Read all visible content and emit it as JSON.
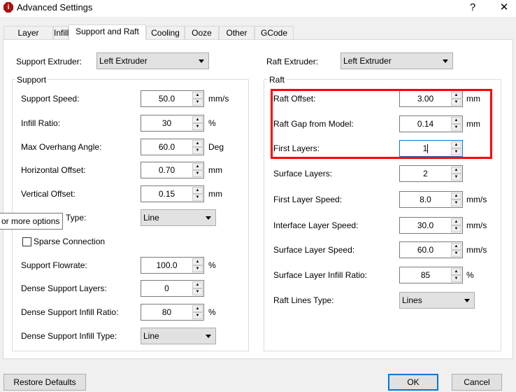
{
  "window": {
    "title": "Advanced Settings",
    "help": "?",
    "close": "✕",
    "icon": "app-logo-icon"
  },
  "tabs": [
    {
      "label": "Layer"
    },
    {
      "label": "Infill"
    },
    {
      "label": "Support and Raft",
      "active": true
    },
    {
      "label": "Cooling"
    },
    {
      "label": "Ooze"
    },
    {
      "label": "Other"
    },
    {
      "label": "GCode"
    }
  ],
  "support_extruder": {
    "label": "Support Extruder:",
    "value": "Left Extruder"
  },
  "raft_extruder": {
    "label": "Raft Extruder:",
    "value": "Left Extruder"
  },
  "support": {
    "title": "Support",
    "rows": [
      {
        "label": "Support Speed:",
        "value": "50.0",
        "unit": "mm/s",
        "type": "spin"
      },
      {
        "label": "Infill Ratio:",
        "value": "30",
        "unit": "%",
        "type": "spin"
      },
      {
        "label": "Max Overhang Angle:",
        "value": "60.0",
        "unit": "Deg",
        "type": "spin"
      },
      {
        "label": "Horizontal Offset:",
        "value": "0.70",
        "unit": "mm",
        "type": "spin"
      },
      {
        "label": "Vertical Offset:",
        "value": "0.15",
        "unit": "mm",
        "type": "spin"
      },
      {
        "label": "Type:",
        "value": "Line",
        "type": "combo"
      },
      {
        "label": "Sparse Connection",
        "checked": false,
        "type": "check"
      },
      {
        "label": "Support Flowrate:",
        "value": "100.0",
        "unit": "%",
        "type": "spin"
      },
      {
        "label": "Dense Support Layers:",
        "value": "0",
        "unit": "",
        "type": "spin"
      },
      {
        "label": "Dense Support Infill Ratio:",
        "value": "80",
        "unit": "%",
        "type": "spin"
      },
      {
        "label": "Dense Support Infill Type:",
        "value": "Line",
        "type": "combo"
      }
    ]
  },
  "raft": {
    "title": "Raft",
    "rows": [
      {
        "label": "Raft Offset:",
        "value": "3.00",
        "unit": "mm",
        "type": "spin"
      },
      {
        "label": "Raft Gap from Model:",
        "value": "0.14",
        "unit": "mm",
        "type": "spin"
      },
      {
        "label": "First Layers:",
        "value": "1",
        "unit": "",
        "type": "spin",
        "focused": true
      },
      {
        "label": "Surface Layers:",
        "value": "2",
        "unit": "",
        "type": "spin"
      },
      {
        "label": "First Layer Speed:",
        "value": "8.0",
        "unit": "mm/s",
        "type": "spin"
      },
      {
        "label": "Interface Layer Speed:",
        "value": "30.0",
        "unit": "mm/s",
        "type": "spin"
      },
      {
        "label": "Surface Layer Speed:",
        "value": "60.0",
        "unit": "mm/s",
        "type": "spin"
      },
      {
        "label": "Surface Layer Infill Ratio:",
        "value": "85",
        "unit": "%",
        "type": "spin"
      },
      {
        "label": "Raft Lines Type:",
        "value": "Lines",
        "type": "combo"
      }
    ]
  },
  "tooltip": "or more options",
  "buttons": {
    "restore": "Restore Defaults",
    "ok": "OK",
    "cancel": "Cancel"
  },
  "colors": {
    "highlight": "#ff0000",
    "focus": "#0078d7"
  }
}
